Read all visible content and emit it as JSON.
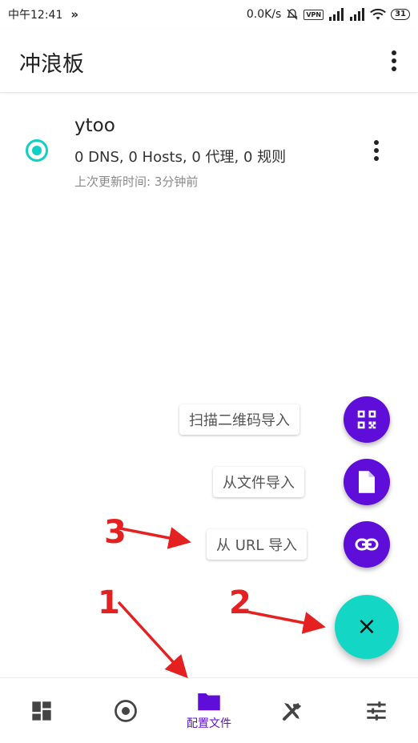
{
  "status_bar": {
    "time": "中午12:41",
    "network_speed": "0.0K/s",
    "vpn": "VPN",
    "battery": "31"
  },
  "app_bar": {
    "title": "冲浪板"
  },
  "profile": {
    "name": "ytoo",
    "stats": "0 DNS, 0 Hosts, 0 代理, 0 规则",
    "updated": "上次更新时间: 3分钟前",
    "selected": true
  },
  "speed_dial": {
    "scan_qr_label": "扫描二维码导入",
    "file_label": "从文件导入",
    "url_label": "从 URL 导入",
    "close_glyph": "×"
  },
  "annotations": {
    "n1": "1",
    "n2": "2",
    "n3": "3",
    "color": "#e52020"
  },
  "bottom_nav": {
    "active_label": "配置文件",
    "items": [
      "dashboard-icon",
      "proxy-icon",
      "folder-icon",
      "tools-icon",
      "settings-icon"
    ]
  },
  "colors": {
    "accent": "#5f0ed9",
    "teal": "#14d6c4"
  }
}
